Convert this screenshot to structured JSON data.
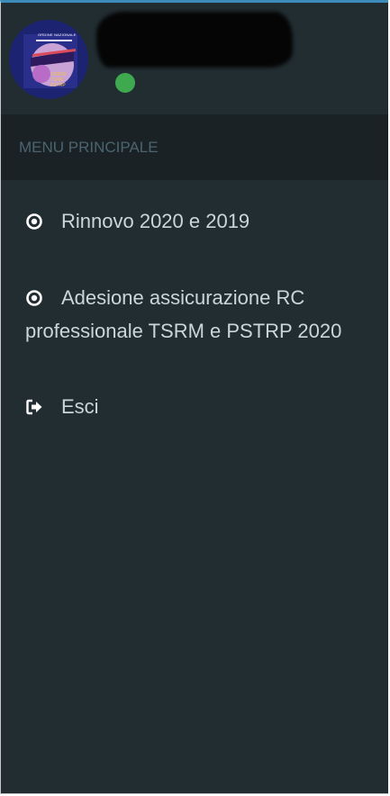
{
  "sidebar": {
    "user": {
      "avatar_icon": "logo-avatar-icon",
      "avatar_text": "ORDINE NAZIONALE",
      "status_color": "#3fa94f"
    },
    "menu_header": "MENU PRINCIPALE",
    "items": [
      {
        "label": "Rinnovo 2020 e 2019",
        "icon": "dot-circle-icon"
      },
      {
        "label": "Adesione assicurazione RC professionale TSRM e PSTRP 2020",
        "icon": "dot-circle-icon"
      },
      {
        "label": "Esci",
        "icon": "sign-out-icon"
      }
    ]
  },
  "colors": {
    "sidebar_bg": "#222d32",
    "header_bg": "#1a2226",
    "header_text": "#4b646f",
    "menu_text": "#b8c7ce"
  }
}
